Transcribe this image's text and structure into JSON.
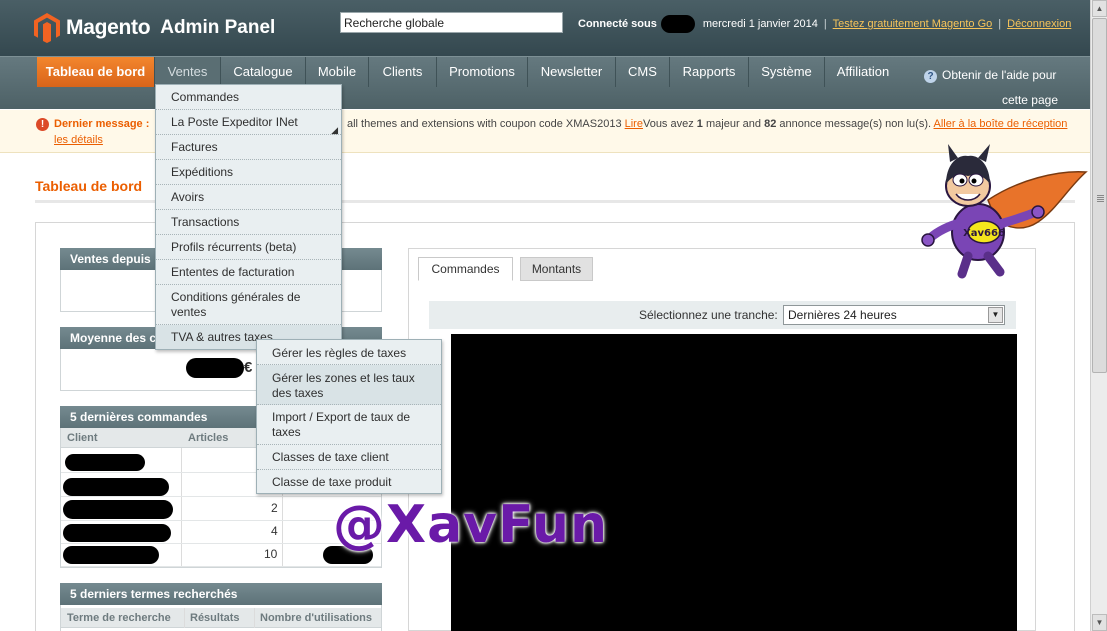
{
  "header": {
    "brand": "Magento",
    "brand_sub": "Admin Panel",
    "search_value": "Recherche globale",
    "logged_as_label": "Connecté sous",
    "date": "mercredi 1 janvier 2014",
    "try_link": "Testez gratuitement Magento Go",
    "logout_link": "Déconnexion",
    "separator": "|"
  },
  "nav": {
    "items": [
      {
        "label": "Tableau de bord"
      },
      {
        "label": "Ventes"
      },
      {
        "label": "Catalogue"
      },
      {
        "label": "Mobile"
      },
      {
        "label": "Clients"
      },
      {
        "label": "Promotions"
      },
      {
        "label": "Newsletter"
      },
      {
        "label": "CMS"
      },
      {
        "label": "Rapports"
      },
      {
        "label": "Système"
      },
      {
        "label": "Affiliation"
      }
    ],
    "help_line1": "Obtenir de l'aide pour",
    "help_line2": "cette page",
    "help_icon_glyph": "?"
  },
  "message": {
    "icon_glyph": "!",
    "label": "Dernier message :",
    "text_pre": "all themes and extensions with coupon code XMAS2013",
    "read_link": "Lire",
    "text_mid1": "Vous avez",
    "major_count": "1",
    "text_mid2": "majeur and",
    "notice_count": "82",
    "text_mid3": "annonce message(s) non lu(s).",
    "inbox_link": "Aller à la boîte de réception",
    "details_link": "les détails"
  },
  "page": {
    "title": "Tableau de bord"
  },
  "panels": {
    "sales_since": "Ventes depuis",
    "avg_orders": "Moyenne des c",
    "currency_symbol": "€",
    "last_orders": "5 dernières commandes",
    "last_orders_columns": [
      "Client",
      "Articles"
    ],
    "last_orders_rows": [
      {
        "articles": ""
      },
      {
        "articles": ""
      },
      {
        "articles": "2"
      },
      {
        "articles": "4"
      },
      {
        "articles": "10"
      }
    ],
    "last_searches": "5 derniers termes recherchés",
    "last_searches_columns": [
      "Terme de recherche",
      "Résultats",
      "Nombre d'utilisations"
    ]
  },
  "chart_panel": {
    "tabs": [
      "Commandes",
      "Montants"
    ],
    "range_label": "Sélectionnez une tranche:",
    "range_value": "Dernières 24 heures",
    "select_arrow_glyph": "▼"
  },
  "ventes_menu": {
    "items": [
      "Commandes",
      "La Poste Expeditor INet",
      "Factures",
      "Expéditions",
      "Avoirs",
      "Transactions",
      "Profils récurrents (beta)",
      "Ententes de facturation",
      "Conditions générales de ventes",
      "TVA & autres taxes"
    ]
  },
  "tax_submenu": {
    "items": [
      "Gérer les règles de taxes",
      "Gérer les zones et les taux des taxes",
      "Import / Export de taux de taxes",
      "Classes de taxe client",
      "Classe de taxe produit"
    ]
  },
  "mascot": {
    "badge_text": "Xav666"
  },
  "watermark": {
    "text": "@XavFun"
  },
  "scrollbar": {
    "up_glyph": "▲",
    "down_glyph": "▼"
  },
  "colors": {
    "header_bg": "#3d5259",
    "nav_bg": "#5a6e73",
    "accent_orange": "#eb5e00",
    "link_yellow": "#f7c45a",
    "dropdown_bg": "#e9eff1",
    "watermark": "#6a1aa8"
  }
}
